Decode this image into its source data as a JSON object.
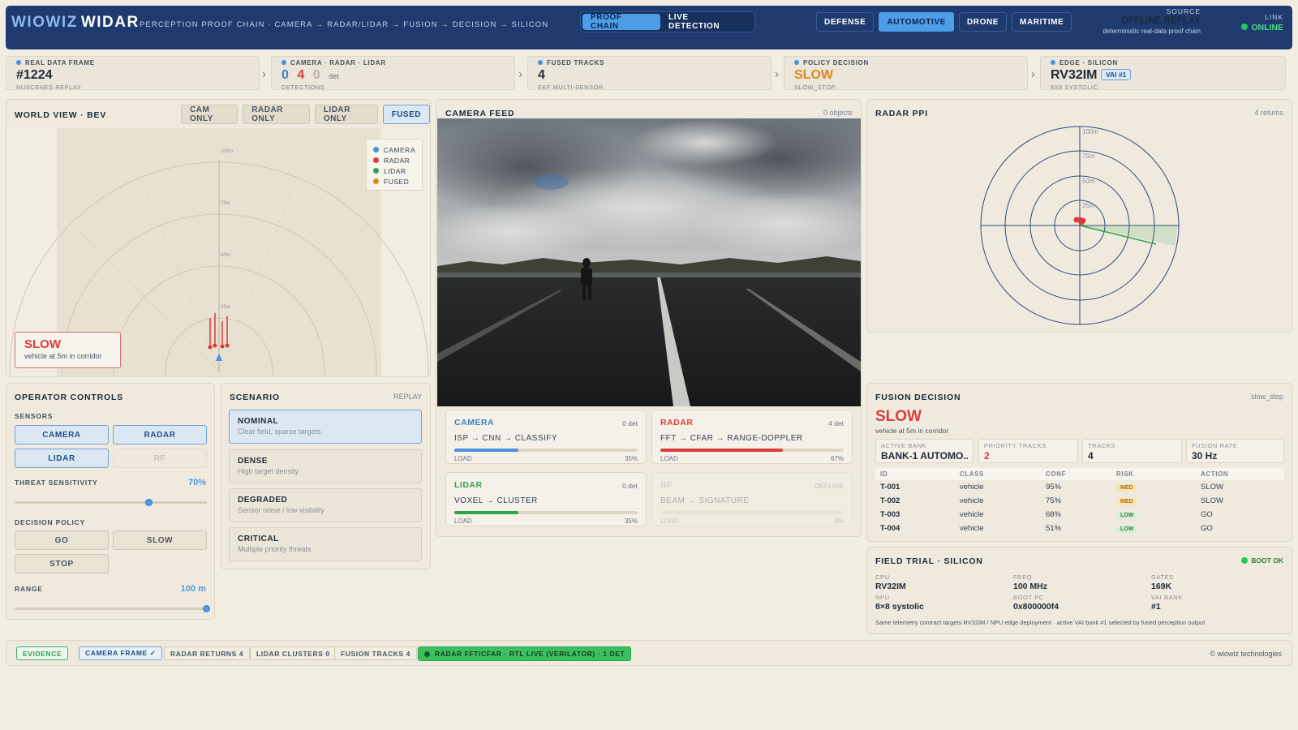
{
  "header": {
    "brand_word1": "WIOWIZ",
    "brand_word2": "WIDAR",
    "tagline": "PERCEPTION PROOF CHAIN · CAMERA → RADAR/LIDAR → FUSION → DECISION → SILICON",
    "modes": [
      "PROOF CHAIN",
      "LIVE DETECTION"
    ],
    "active_mode": "PROOF CHAIN",
    "domains": [
      "DEFENSE",
      "AUTOMOTIVE",
      "DRONE",
      "MARITIME"
    ],
    "active_domain": "AUTOMOTIVE",
    "source_label": "SOURCE",
    "source_value": "OFFLINE REPLAY",
    "source_sub": "deterministic real-data proof chain",
    "link_label": "LINK",
    "link_value": "ONLINE"
  },
  "chain": {
    "frame": {
      "label": "REAL DATA FRAME",
      "value": "#1224",
      "sub": "NUSCENES REPLAY"
    },
    "sensors": {
      "label": "CAMERA · RADAR · LIDAR",
      "cam": "0",
      "radar": "4",
      "lidar": "0",
      "unit": "det",
      "sub": "DETECTIONS"
    },
    "fused": {
      "label": "FUSED TRACKS",
      "value": "4",
      "sub": "EKF MULTI-SENSOR"
    },
    "policy": {
      "label": "POLICY DECISION",
      "value": "SLOW",
      "sub": "SLOW_STOP"
    },
    "edge": {
      "label": "EDGE · SILICON",
      "value": "RV32IM",
      "badge": "VAI #1",
      "sub": "8X8 SYSTOLIC"
    },
    "chevron": "›"
  },
  "world": {
    "title": "WORLD VIEW · BEV",
    "views": [
      "CAM ONLY",
      "RADAR ONLY",
      "LIDAR ONLY",
      "FUSED"
    ],
    "active_view": "FUSED",
    "legend": [
      {
        "name": "CAMERA",
        "color": "#4d8fe0"
      },
      {
        "name": "RADAR",
        "color": "#dc3b3b"
      },
      {
        "name": "LIDAR",
        "color": "#2ea44f"
      },
      {
        "name": "FUSED",
        "color": "#d98a1a"
      }
    ],
    "ranges": [
      "100m",
      "75m",
      "50m",
      "25m"
    ],
    "alert_title": "SLOW",
    "alert_sub": "vehicle at 5m in corridor"
  },
  "camera": {
    "title": "CAMERA FEED",
    "meta": "0 objects"
  },
  "pipelines": [
    {
      "name": "CAMERA",
      "count": "0 det",
      "path": "ISP → CNN → CLASSIFY",
      "load_label": "LOAD",
      "load": "35%",
      "fill": 0.35,
      "color": "#4d8fe0",
      "offline": false
    },
    {
      "name": "RADAR",
      "count": "4 det",
      "path": "FFT → CFAR → RANGE-DOPPLER",
      "load_label": "LOAD",
      "load": "67%",
      "fill": 0.67,
      "color": "#dc3b3b",
      "offline": false
    },
    {
      "name": "LIDAR",
      "count": "0 det",
      "path": "VOXEL → CLUSTER",
      "load_label": "LOAD",
      "load": "35%",
      "fill": 0.35,
      "color": "#2ea44f",
      "offline": false
    },
    {
      "name": "RF",
      "count": "OFFLINE",
      "path": "BEAM → SIGNATURE",
      "load_label": "LOAD",
      "load": "0%",
      "fill": 0,
      "color": "#9ca3af",
      "offline": true
    }
  ],
  "radar": {
    "title": "RADAR PPI",
    "meta": "4 returns",
    "rings": [
      "100m",
      "75m",
      "50m",
      "25m"
    ]
  },
  "operator": {
    "title": "OPERATOR CONTROLS",
    "sensors_label": "SENSORS",
    "sensors": [
      {
        "name": "CAMERA",
        "state": "on"
      },
      {
        "name": "RADAR",
        "state": "on"
      },
      {
        "name": "LIDAR",
        "state": "on"
      },
      {
        "name": "RF",
        "state": "disabled"
      }
    ],
    "sensitivity_label": "THREAT SENSITIVITY",
    "sensitivity_value": "70%",
    "sensitivity": 0.7,
    "policy_label": "DECISION POLICY",
    "policies": [
      "GO",
      "SLOW",
      "STOP"
    ],
    "range_label": "RANGE",
    "range_value": "100 m",
    "range_fraction": 1.0
  },
  "scenario": {
    "title": "SCENARIO",
    "meta": "REPLAY",
    "items": [
      {
        "name": "NOMINAL",
        "desc": "Clear field, sparse targets",
        "active": true
      },
      {
        "name": "DENSE",
        "desc": "High target density",
        "active": false
      },
      {
        "name": "DEGRADED",
        "desc": "Sensor noise / low visibility",
        "active": false
      },
      {
        "name": "CRITICAL",
        "desc": "Multiple priority threats",
        "active": false
      }
    ]
  },
  "fusion": {
    "title": "FUSION DECISION",
    "meta": "slow_stop",
    "decision": "SLOW",
    "decision_sub": "vehicle at 5m in corridor",
    "active_bank_label": "ACTIVE BANK",
    "active_bank": "BANK-1 AUTOMO...",
    "priority_label": "PRIORITY TRACKS",
    "priority": "2",
    "tracks_label": "TRACKS",
    "tracks": "4",
    "rate_label": "FUSION RATE",
    "rate": "30 Hz",
    "columns": [
      "ID",
      "CLASS",
      "CONF",
      "RISK",
      "ACTION"
    ],
    "rows": [
      {
        "id": "T-001",
        "cls": "vehicle",
        "conf": "95%",
        "risk": "MED",
        "action": "SLOW"
      },
      {
        "id": "T-002",
        "cls": "vehicle",
        "conf": "75%",
        "risk": "MED",
        "action": "SLOW"
      },
      {
        "id": "T-003",
        "cls": "vehicle",
        "conf": "68%",
        "risk": "LOW",
        "action": "GO"
      },
      {
        "id": "T-004",
        "cls": "vehicle",
        "conf": "51%",
        "risk": "LOW",
        "action": "GO"
      }
    ]
  },
  "field": {
    "title": "FIELD TRIAL · SILICON",
    "status": "BOOT OK",
    "cpu_label": "CPU",
    "cpu": "RV32IM",
    "freq_label": "FREQ",
    "freq": "100 MHz",
    "gates_label": "GATES",
    "gates": "169K",
    "npu_label": "NPU",
    "npu": "8×8 systolic",
    "bootpc_label": "BOOT PC",
    "bootpc": "0x800000f4",
    "vai_label": "VAI BANK",
    "vai": "#1",
    "note": "Same telemetry contract targets RV32IM / NPU edge deployment · active VAI bank #1 selected by fused perception output"
  },
  "evidence": {
    "label": "EVIDENCE",
    "chips": [
      "CAMERA FRAME ✓",
      "RADAR RETURNS 4",
      "LIDAR CLUSTERS 0",
      "FUSION TRACKS 4"
    ],
    "rtl": "RADAR FFT/CFAR · RTL LIVE (VERILATOR) · 1 DET",
    "copyright": "© wiowiz technologies"
  }
}
